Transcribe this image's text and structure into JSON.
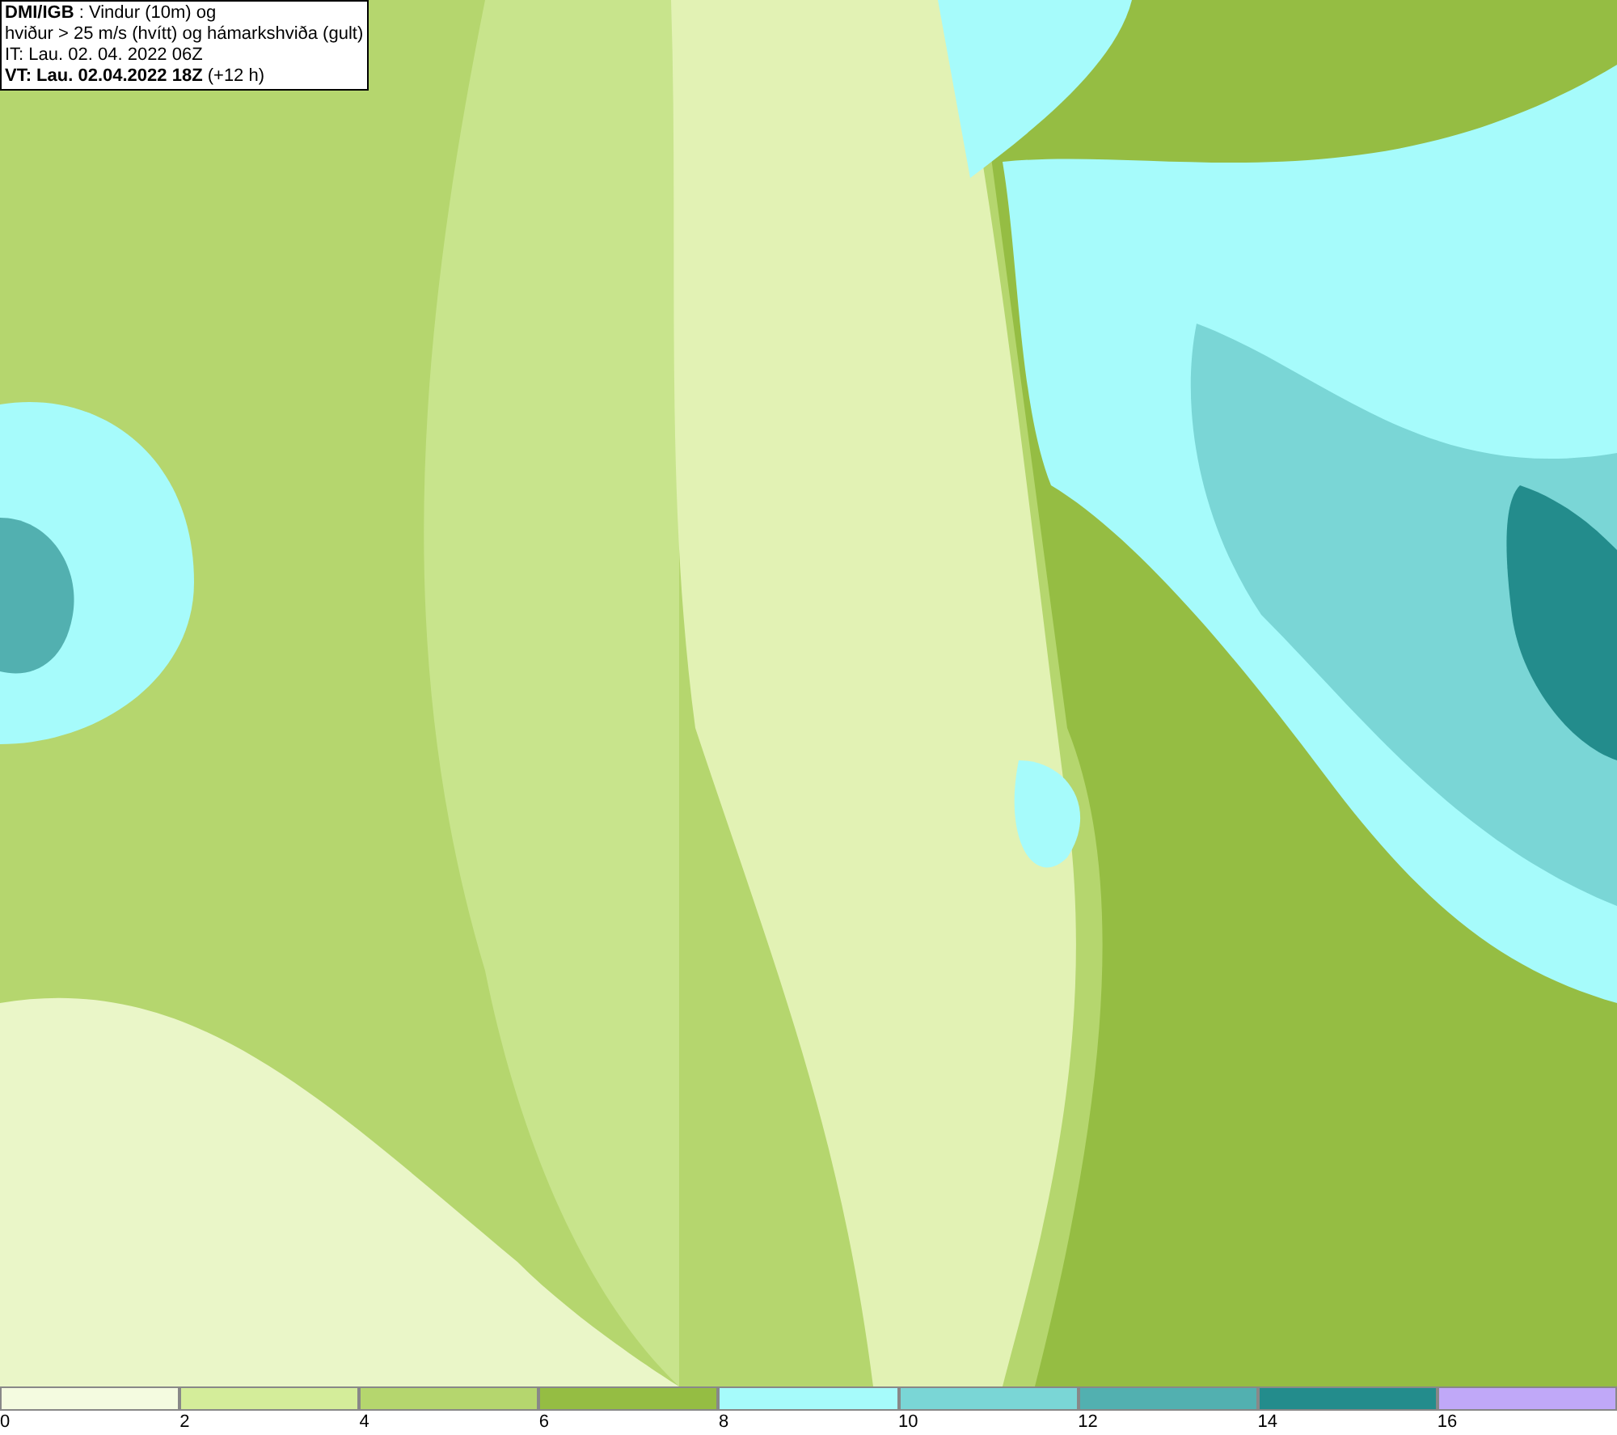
{
  "info_box": {
    "lines": [
      "**DMI/IGB** : Vindur (10m) og",
      "hviður > 25 m/s (hvítt) og hámarkshviða (gult)",
      "IT: Lau. 02. 04. 2022 06Z",
      "**VT: Lau. 02.04.2022 18Z** (+12 h)"
    ]
  },
  "legend": [
    {
      "label": "0",
      "color": "#f4fbe0"
    },
    {
      "label": "2",
      "color": "#d4ed9a"
    },
    {
      "label": "4",
      "color": "#b5d66e"
    },
    {
      "label": "6",
      "color": "#95bd43"
    },
    {
      "label": "8",
      "color": "#a6fbfb"
    },
    {
      "label": "10",
      "color": "#7ad6d6"
    },
    {
      "label": "12",
      "color": "#52b0b0"
    },
    {
      "label": "14",
      "color": "#238c8c"
    },
    {
      "label": "16",
      "color": "#c0a8f8"
    }
  ]
}
